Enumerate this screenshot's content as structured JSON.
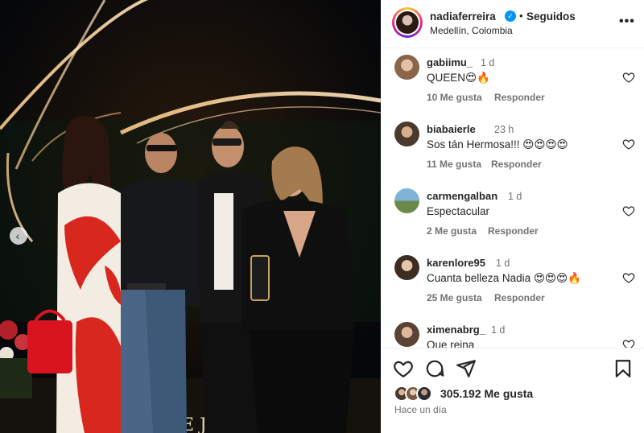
{
  "header": {
    "username": "nadiaferreira",
    "verified_icon": "verified-badge-icon",
    "separator": "•",
    "follow_status": "Seguidos",
    "location": "Medellín, Colombia",
    "more_icon": "more-options-icon"
  },
  "photo": {
    "description_icon": "post-photo",
    "prev_icon": "chevron-left-icon",
    "letters": "E J"
  },
  "comments": [
    {
      "user": "gabiimu_",
      "time": "1 d",
      "text": "QUEEN😍🔥",
      "likes": "10 Me gusta",
      "reply": "Responder"
    },
    {
      "user": "biabaierle",
      "time": "23 h",
      "text": "Sos tán Hermosa!!! 😍😍😍😍",
      "likes": "11 Me gusta",
      "reply": "Responder"
    },
    {
      "user": "carmengalban",
      "time": "1 d",
      "text": "Espectacular",
      "likes": "2 Me gusta",
      "reply": "Responder"
    },
    {
      "user": "karenlore95",
      "time": "1 d",
      "text": "Cuanta belleza Nadia 😍😍😍🔥",
      "likes": "25 Me gusta",
      "reply": "Responder"
    },
    {
      "user": "ximenabrg_",
      "time": "1 d",
      "text": "Que reina",
      "likes": "",
      "reply": ""
    }
  ],
  "actions": {
    "like_icon": "heart-icon",
    "comment_icon": "comment-icon",
    "share_icon": "share-icon",
    "save_icon": "bookmark-icon",
    "likes_count": "305.192 Me gusta",
    "posted": "Hace un día"
  },
  "colors": {
    "accent_blue": "#0095f6",
    "secondary_text": "#737373",
    "primary_text": "#262626"
  }
}
